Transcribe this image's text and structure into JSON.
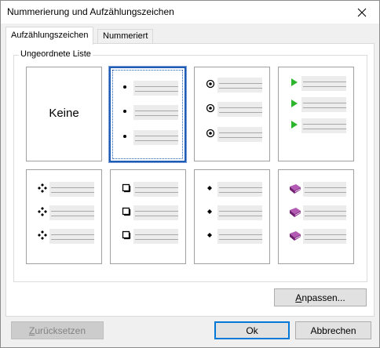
{
  "window": {
    "title": "Nummerierung und Aufzählungszeichen"
  },
  "tabs": [
    {
      "label": "Aufzählungszeichen",
      "active": true
    },
    {
      "label": "Nummeriert",
      "active": false
    }
  ],
  "group": {
    "label": "Ungeordnete Liste"
  },
  "tiles": [
    {
      "label": "Keine",
      "marker": "none"
    },
    {
      "marker": "small-dot",
      "selected": true
    },
    {
      "marker": "circle-dot"
    },
    {
      "marker": "green-triangle"
    },
    {
      "marker": "four-diamonds"
    },
    {
      "marker": "square-outline"
    },
    {
      "marker": "small-diamond"
    },
    {
      "marker": "purple-book"
    }
  ],
  "buttons": {
    "customize": {
      "mnemonic": "A",
      "rest": "npassen..."
    },
    "reset": {
      "mnemonic": "Z",
      "rest": "urücksetzen"
    },
    "ok": "Ok",
    "cancel": "Abbrechen"
  },
  "colors": {
    "selection": "#1e5bb5",
    "green_marker": "#2db52d",
    "purple_marker": "#8a2c8a",
    "default_button_border": "#0078d7"
  }
}
